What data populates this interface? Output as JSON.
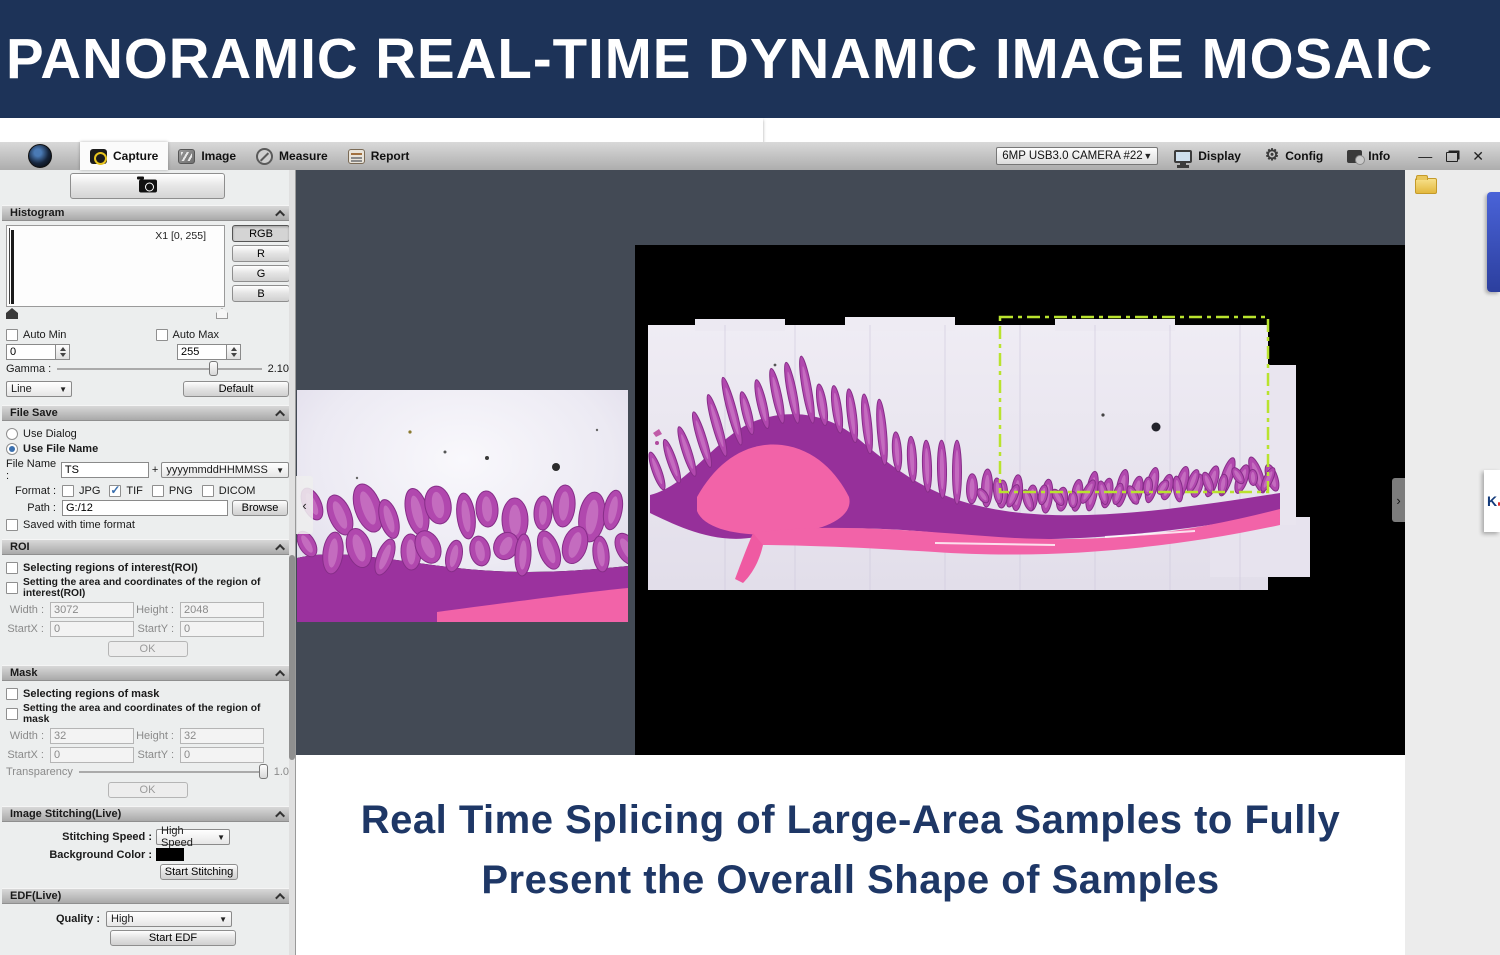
{
  "colors": {
    "banner-bg": "#1d3358",
    "caption-color": "#1e3766",
    "main-bg": "#434a55",
    "desktop-bg": "#ececec",
    "check-blue": "#3a6fae",
    "roi-green": "#b9e32e",
    "tissue-bg": "#e9e6f0",
    "villi": "#b148ae",
    "villi-stroke": "#862d88",
    "dense": "#96309a",
    "pink": "#f263a8"
  },
  "banner": {
    "title": "PANORAMIC REAL-TIME DYNAMIC IMAGE MOSAIC"
  },
  "toolbar": {
    "tabs": [
      {
        "label": "Capture"
      },
      {
        "label": "Image"
      },
      {
        "label": "Measure"
      },
      {
        "label": "Report"
      }
    ],
    "camera_select": "6MP USB3.0 CAMERA #22",
    "display_label": "Display",
    "config_label": "Config",
    "info_label": "Info"
  },
  "sidebar": {
    "histogram": {
      "title": "Histogram",
      "range_label": "X1 [0, 255]",
      "channel_buttons": [
        "RGB",
        "R",
        "G",
        "B"
      ],
      "auto_min_label": "Auto Min",
      "auto_max_label": "Auto Max",
      "min_value": "0",
      "max_value": "255",
      "gamma_label": "Gamma :",
      "gamma_value": "2.10",
      "curve_type": "Line",
      "default_button": "Default"
    },
    "file_save": {
      "title": "File Save",
      "use_dialog_label": "Use Dialog",
      "use_file_name_label": "Use File Name",
      "file_name_label": "File Name :",
      "file_name_value": "TS",
      "plus_label": "+",
      "timestamp_format": "yyyymmddHHMMSS",
      "format_label": "Format :",
      "formats": [
        {
          "label": "JPG",
          "checked": false
        },
        {
          "label": "TIF",
          "checked": true
        },
        {
          "label": "PNG",
          "checked": false
        },
        {
          "label": "DICOM",
          "checked": false
        }
      ],
      "path_label": "Path :",
      "path_value": "G:/12",
      "browse_button": "Browse",
      "time_format_label": "Saved with time format"
    },
    "roi": {
      "title": "ROI",
      "select_label": "Selecting regions of interest(ROI)",
      "setting_label": "Setting the area and coordinates of the region of interest(ROI)",
      "width_label": "Width :",
      "width_value": "3072",
      "height_label": "Height :",
      "height_value": "2048",
      "startx_label": "StartX :",
      "startx_value": "0",
      "starty_label": "StartY :",
      "starty_value": "0",
      "ok_button": "OK"
    },
    "mask": {
      "title": "Mask",
      "select_label": "Selecting regions of mask",
      "setting_label": "Setting the area and coordinates of the region of mask",
      "width_label": "Width :",
      "width_value": "32",
      "height_label": "Height :",
      "height_value": "32",
      "startx_label": "StartX :",
      "startx_value": "0",
      "starty_label": "StartY :",
      "starty_value": "0",
      "transparency_label": "Transparency",
      "transparency_value": "1.0",
      "ok_button": "OK"
    },
    "stitching": {
      "title": "Image Stitching(Live)",
      "speed_label": "Stitching Speed :",
      "speed_value": "High Speed",
      "bg_color_label": "Background Color :",
      "start_button": "Start Stitching"
    },
    "edf": {
      "title": "EDF(Live)",
      "quality_label": "Quality :",
      "quality_value": "High",
      "start_button": "Start EDF"
    }
  },
  "main": {
    "caption_line1": "Real Time Splicing of Large-Area Samples to Fully",
    "caption_line2": "Present the Overall Shape of Samples"
  },
  "desktop": {
    "partial_logo_text": "K"
  }
}
